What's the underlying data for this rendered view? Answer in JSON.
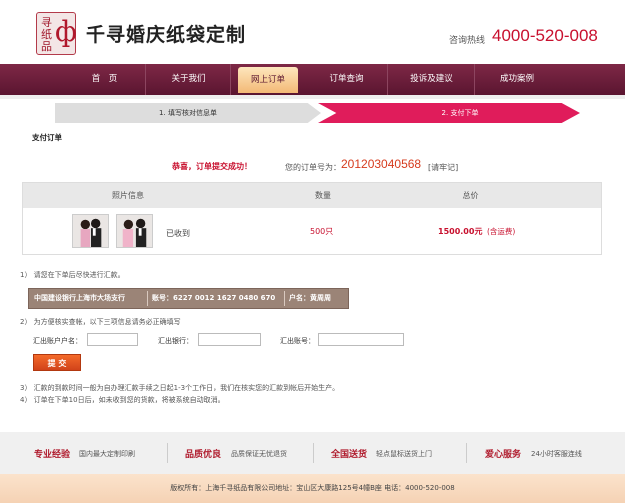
{
  "header": {
    "logo_text": "寻纸品",
    "brand": "千寻婚庆纸袋定制",
    "hotline_label": "咨询热线",
    "hotline": "4000-520-008"
  },
  "nav": {
    "items": [
      {
        "label": "首　页"
      },
      {
        "label": "关于我们"
      },
      {
        "label": "网上订单"
      },
      {
        "label": "订单查询"
      },
      {
        "label": "投诉及建议"
      },
      {
        "label": "成功案例"
      }
    ],
    "active_index": 2
  },
  "steps": {
    "step1": "1. 填写核对信息单",
    "step2": "2. 支付下单"
  },
  "section_title": "支付订单",
  "order": {
    "success_text": "恭喜，订单提交成功！",
    "number_label": "您的订单号为：",
    "number": "201203040568",
    "number_note": "[请牢记]"
  },
  "table": {
    "headers": [
      "照片信息",
      "数量",
      "总价"
    ],
    "row": {
      "photo_status": "已收到",
      "quantity": "500只",
      "price": "1500.00元",
      "price_note": "(含运费)"
    }
  },
  "instructions": {
    "note1": "1） 请您在下单后尽快进行汇款。",
    "bank": {
      "name": "中国建设银行上海市大场支行",
      "account": "账号：6227 0012 1627 0480 670",
      "holder": "户名：黄周周"
    },
    "note2": "2） 为方便核实查帐，以下三项信息请务必正确填写",
    "fields": {
      "payer_name_label": "汇出账户户名：",
      "payer_bank_label": "汇出银行：",
      "payer_account_label": "汇出账号："
    },
    "submit_label": "提 交",
    "note3": "3） 汇款的到款时间一般为自办理汇款手续之日起1-3个工作日，我们在核实您的汇款到帐后开始生产。",
    "note4": "4） 订单在下单10日后，如未收到您的货款，将被系统自动取消。"
  },
  "features": [
    {
      "title": "专业经验",
      "desc": "国内最大定制印刷"
    },
    {
      "title": "品质优良",
      "desc": "品质保证无忧退货"
    },
    {
      "title": "全国送货",
      "desc": "轻点鼠标送货上门"
    },
    {
      "title": "爱心服务",
      "desc": "24小时客服连线"
    }
  ],
  "footer": {
    "copyright": "版权所有：上海千寻纸品有限公司地址：宝山区大康路125号4幢B座 电话：4000-520-008"
  },
  "colors": {
    "brand_red": "#c8102e",
    "nav_bg": "#6b1d3b",
    "nav_active": "#f7c98e",
    "step_active": "#e01c5b"
  }
}
